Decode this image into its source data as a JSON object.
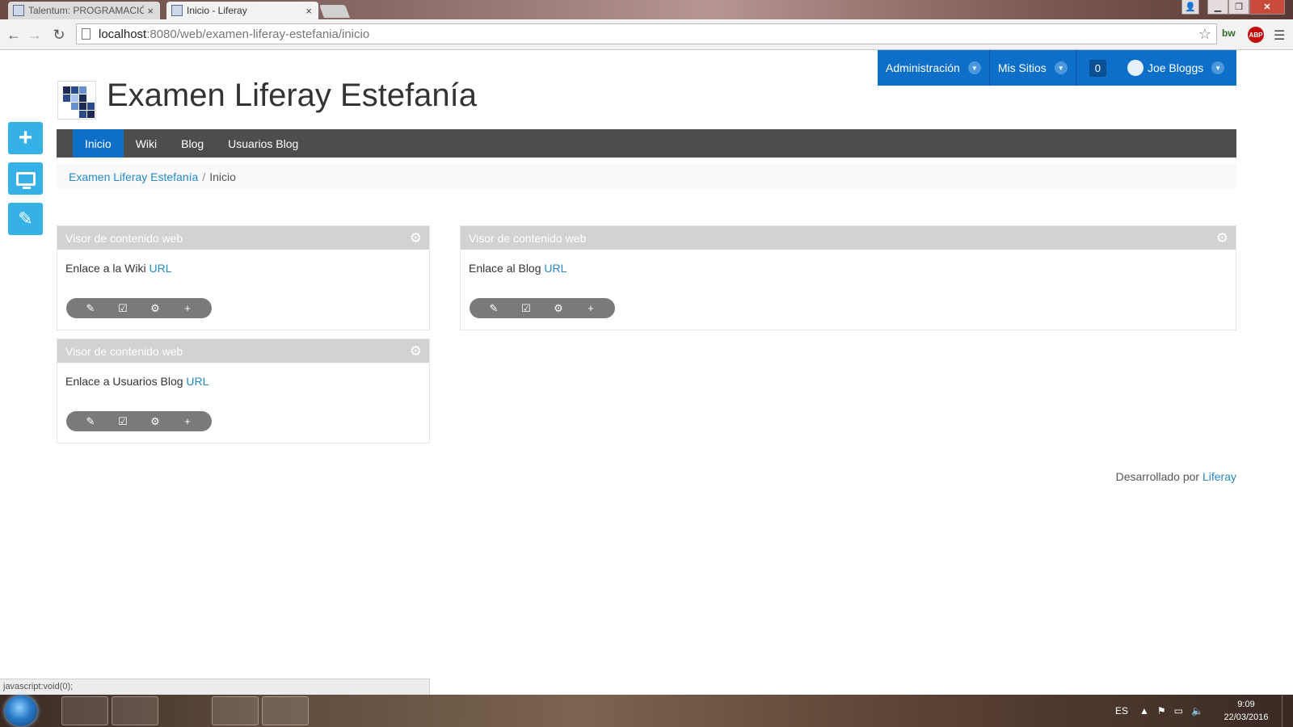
{
  "browser": {
    "tabs": [
      {
        "label": "Talentum: PROGRAMACIÓ",
        "close": "×"
      },
      {
        "label": "Inicio - Liferay",
        "close": "×"
      }
    ],
    "window_controls": {
      "min": "▁",
      "max": "❐",
      "close": "✕"
    },
    "url_host": "localhost",
    "url_rest": ":8080/web/examen-liferay-estefania/inicio",
    "extensions": {
      "bw": "bw",
      "abp": "ABP"
    },
    "icons": [
      "back-arrow-icon",
      "forward-arrow-icon",
      "reload-icon",
      "page-icon",
      "star-icon",
      "menu-icon"
    ]
  },
  "dockbar": {
    "admin_label": "Administración",
    "sites_label": "Mis Sitios",
    "notifications_count": "0",
    "user_name": "Joe Bloggs"
  },
  "site": {
    "title": "Examen Liferay Estefanía",
    "nav": [
      "Inicio",
      "Wiki",
      "Blog",
      "Usuarios Blog"
    ],
    "selected_nav": "Inicio",
    "breadcrumb": {
      "site": "Examen Liferay Estefanía",
      "divider": "/",
      "current": "Inicio"
    },
    "colors": {
      "dockbar": "#0d6fc7",
      "nav": "#4d4d4d",
      "link": "#2589c3",
      "side_buttons": "#36b1e8"
    }
  },
  "portlets": [
    {
      "title": "Visor de contenido web",
      "text": "Enlace a la Wiki",
      "link": "URL"
    },
    {
      "title": "Visor de contenido web",
      "text": "Enlace al Blog",
      "link": "URL"
    },
    {
      "title": "Visor de contenido web",
      "text": "Enlace a Usuarios Blog",
      "link": "URL"
    }
  ],
  "footer": {
    "text": "Desarrollado por",
    "link": "Liferay"
  },
  "statusbar": {
    "text": "javascript:void(0);"
  },
  "taskbar": {
    "language": "ES",
    "time": "9:09",
    "date": "22/03/2016"
  }
}
